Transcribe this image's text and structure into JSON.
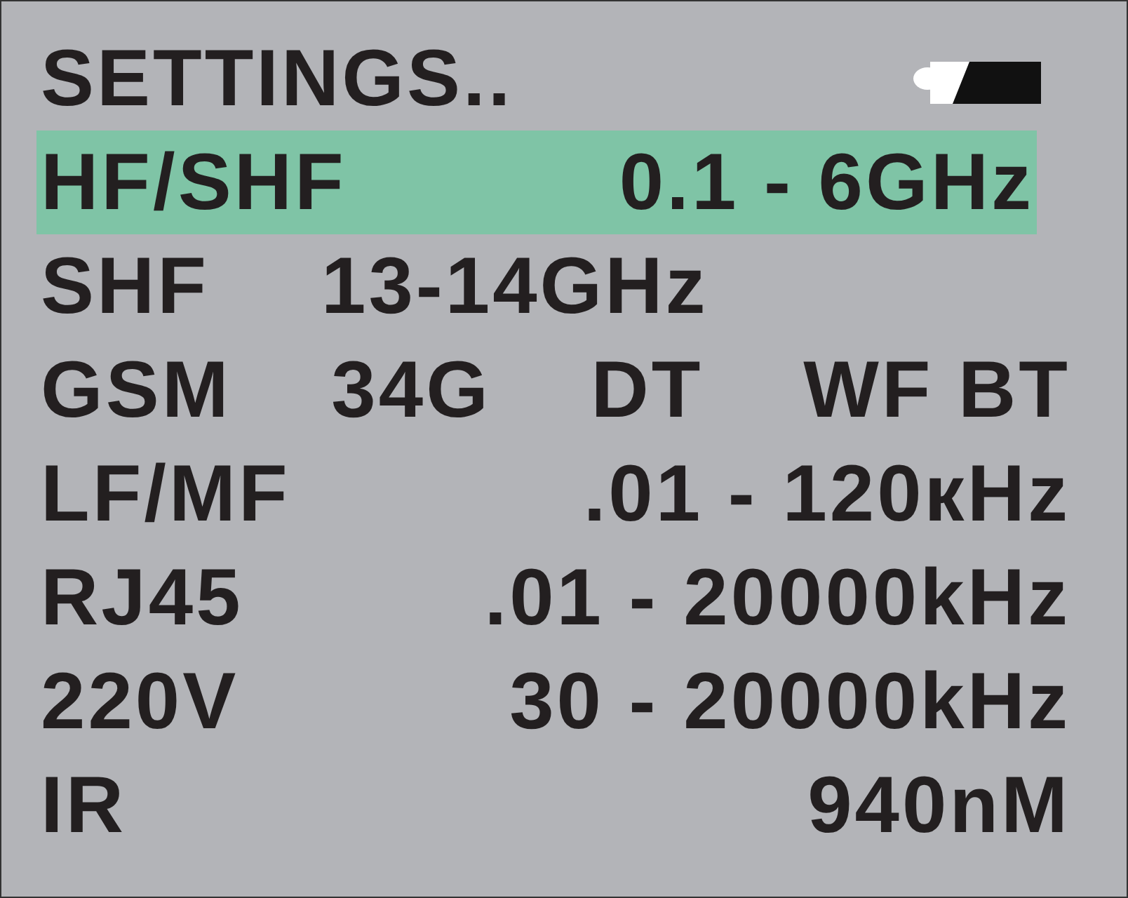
{
  "title": "SETTINGS..",
  "rows": [
    {
      "kind": "spread",
      "selected": true,
      "parts": [
        "HF/SHF",
        "0.1 - 6GHz"
      ]
    },
    {
      "kind": "inline",
      "selected": false,
      "parts": [
        "SHF",
        "13-14GHz"
      ]
    },
    {
      "kind": "spread",
      "selected": false,
      "parts": [
        "GSM",
        "34G",
        "DT",
        "WF BT"
      ]
    },
    {
      "kind": "spread",
      "selected": false,
      "parts": [
        "LF/MF",
        ".01 - 120кHz"
      ]
    },
    {
      "kind": "spread",
      "selected": false,
      "parts": [
        "RJ45",
        ".01 - 20000kHz"
      ]
    },
    {
      "kind": "spread",
      "selected": false,
      "parts": [
        "220V",
        "30 - 20000kHz"
      ]
    },
    {
      "kind": "spread",
      "selected": false,
      "parts": [
        "IR",
        "940nM"
      ]
    }
  ]
}
